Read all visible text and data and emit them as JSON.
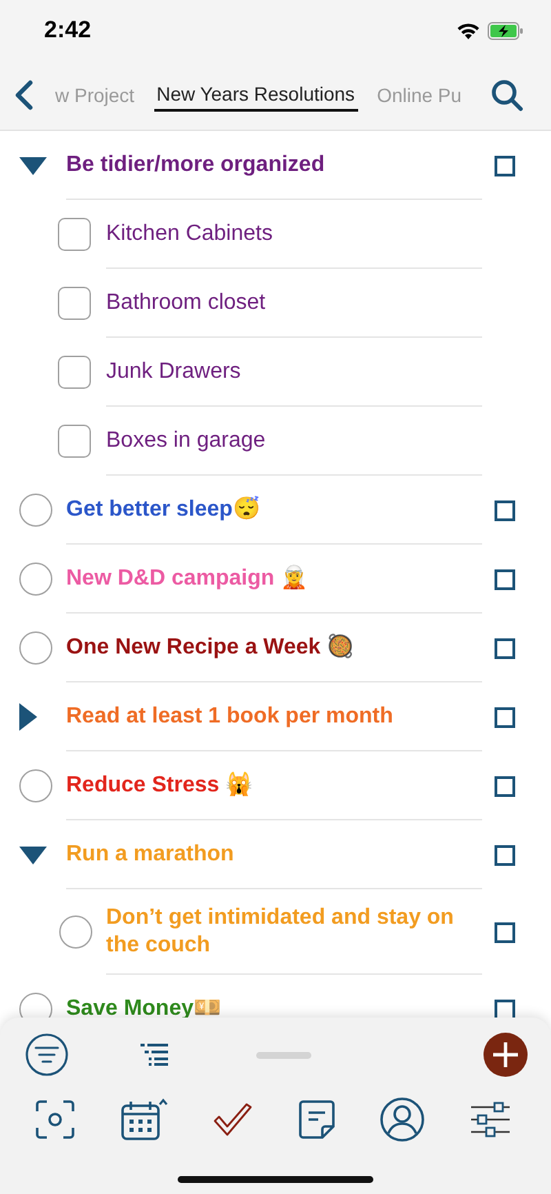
{
  "status_bar": {
    "time": "2:42"
  },
  "tabs": [
    {
      "label": "w Project",
      "selected": false
    },
    {
      "label": "New Years Resolutions",
      "selected": true
    },
    {
      "label": "Online Pu",
      "selected": false
    }
  ],
  "items": [
    {
      "kind": "group",
      "title": "Be tidier/more organized",
      "color": "#6e1f7f",
      "expanded": true,
      "checked": false,
      "children": [
        {
          "kind": "subtask",
          "title": "Kitchen Cabinets",
          "color": "#6e1f7f",
          "done": false
        },
        {
          "kind": "subtask",
          "title": "Bathroom closet",
          "color": "#6e1f7f",
          "done": false
        },
        {
          "kind": "subtask",
          "title": "Junk Drawers",
          "color": "#6e1f7f",
          "done": false
        },
        {
          "kind": "subtask",
          "title": "Boxes in garage",
          "color": "#6e1f7f",
          "done": false
        }
      ]
    },
    {
      "kind": "task",
      "title": "Get better sleep😴",
      "color": "#2b56c9",
      "done": false,
      "checked": false
    },
    {
      "kind": "task",
      "title": "New D&D campaign 🧝",
      "color": "#ec5ba3",
      "done": false,
      "checked": false
    },
    {
      "kind": "task",
      "title": "One New Recipe a Week 🥘",
      "color": "#9a1212",
      "done": false,
      "checked": false
    },
    {
      "kind": "group",
      "title": "Read at least 1 book per month",
      "color": "#ef6c25",
      "expanded": false,
      "checked": false
    },
    {
      "kind": "task",
      "title": "Reduce Stress 🙀",
      "color": "#e2251c",
      "done": false,
      "checked": false
    },
    {
      "kind": "group",
      "title": "Run a marathon",
      "color": "#f29c20",
      "expanded": true,
      "checked": false,
      "children": [
        {
          "kind": "task",
          "title": "Don’t get intimidated and stay on the couch",
          "color": "#f29c20",
          "done": false,
          "checked": false
        }
      ]
    },
    {
      "kind": "task",
      "title": "Save Money💴",
      "color": "#2f8a1d",
      "done": false,
      "checked": false
    }
  ],
  "bottom_tabs": [
    {
      "selected": false
    },
    {
      "selected": false
    },
    {
      "selected": true
    },
    {
      "selected": false
    },
    {
      "selected": false
    },
    {
      "selected": false
    }
  ]
}
